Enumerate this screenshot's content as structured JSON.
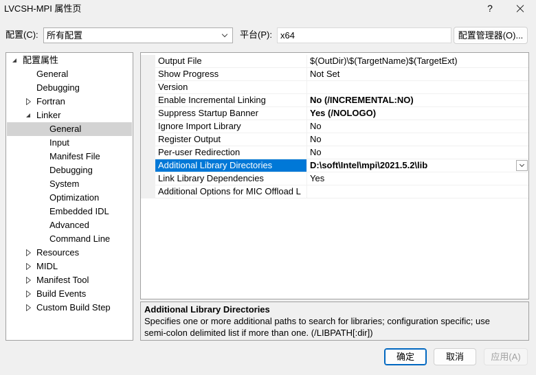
{
  "window": {
    "title": "LVCSH-MPI 属性页",
    "help_label": "?"
  },
  "icons": {
    "close": "close-icon",
    "expanded": "expanded-arrow-icon",
    "collapsed": "collapsed-arrow-icon",
    "dropdown": "chevron-down-icon"
  },
  "config_bar": {
    "configuration_label": "配置(C):",
    "configuration_value": "所有配置",
    "platform_label": "平台(P):",
    "platform_value": "x64",
    "configuration_manager_label": "配置管理器(O)..."
  },
  "tree": {
    "root": {
      "label": "配置属性",
      "expanded": true,
      "children": [
        {
          "label": "General"
        },
        {
          "label": "Debugging"
        },
        {
          "label": "Fortran",
          "expanded": false
        },
        {
          "label": "Linker",
          "expanded": true,
          "children": [
            {
              "label": "General",
              "selected": true
            },
            {
              "label": "Input"
            },
            {
              "label": "Manifest File"
            },
            {
              "label": "Debugging"
            },
            {
              "label": "System"
            },
            {
              "label": "Optimization"
            },
            {
              "label": "Embedded IDL"
            },
            {
              "label": "Advanced"
            },
            {
              "label": "Command Line"
            }
          ]
        },
        {
          "label": "Resources",
          "expanded": false
        },
        {
          "label": "MIDL",
          "expanded": false
        },
        {
          "label": "Manifest Tool",
          "expanded": false
        },
        {
          "label": "Build Events",
          "expanded": false
        },
        {
          "label": "Custom Build Step",
          "expanded": false
        }
      ]
    }
  },
  "property_grid": {
    "rows": [
      {
        "name": "Output File",
        "value": "$(OutDir)\\$(TargetName)$(TargetExt)"
      },
      {
        "name": "Show Progress",
        "value": "Not Set"
      },
      {
        "name": "Version"
      },
      {
        "name": "Enable Incremental Linking",
        "value": "No (/INCREMENTAL:NO)",
        "modified": true
      },
      {
        "name": "Suppress Startup Banner",
        "value": "Yes (/NOLOGO)",
        "modified": true
      },
      {
        "name": "Ignore Import Library",
        "value": "No"
      },
      {
        "name": "Register Output",
        "value": "No"
      },
      {
        "name": "Per-user Redirection",
        "value": "No"
      },
      {
        "name": "Additional Library Directories",
        "value": "D:\\soft\\Intel\\mpi\\2021.5.2\\lib",
        "modified": true,
        "selected": true
      },
      {
        "name": "Link Library Dependencies",
        "value": "Yes"
      },
      {
        "name": "Additional Options for MIC Offload L"
      }
    ]
  },
  "description": {
    "title": "Additional Library Directories",
    "lines": [
      "Specifies one or more additional paths to search for libraries; configuration specific; use",
      "semi-colon delimited list if more than one. (/LIBPATH[:dir])"
    ]
  },
  "buttons": {
    "ok": "确定",
    "cancel": "取消",
    "apply": "应用(A)",
    "apply_enabled": false
  },
  "colors": {
    "selection_accent": "#0078d7",
    "tree_selection": "#d3d3d3",
    "default_button_border": "#0067c0",
    "disabled_text": "#a0a0a0"
  }
}
